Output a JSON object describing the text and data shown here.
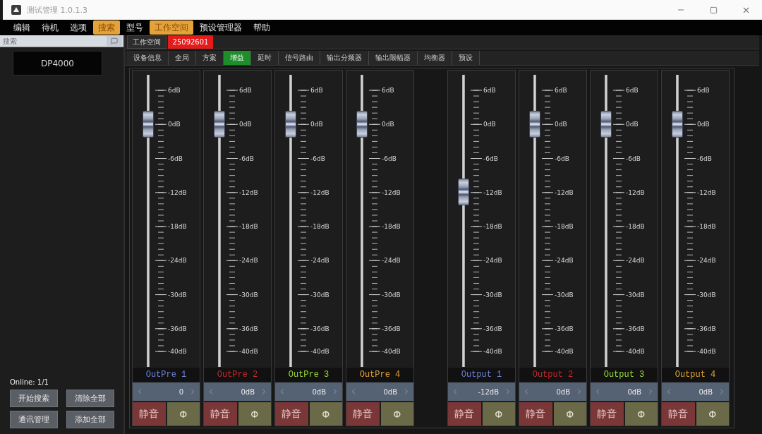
{
  "window": {
    "title": "测试管理 1.0.1.3"
  },
  "menu": [
    {
      "label": "编辑",
      "selected": false
    },
    {
      "label": "待机",
      "selected": false
    },
    {
      "label": "选项",
      "selected": false
    },
    {
      "label": "搜索",
      "selected": true
    },
    {
      "label": "型号",
      "selected": false
    },
    {
      "label": "工作空间",
      "selected": true
    },
    {
      "label": "预设管理器",
      "selected": false
    },
    {
      "label": "帮助",
      "selected": false
    }
  ],
  "sidebar": {
    "search": {
      "placeholder": "搜索"
    },
    "devices": [
      {
        "name": "DP4000",
        "selected": true
      }
    ],
    "status": "Online: 1/1",
    "buttons": [
      "开始搜索",
      "清除全部",
      "通讯管理",
      "添加全部"
    ]
  },
  "workspace": {
    "label": "工作空间",
    "value": "25092601"
  },
  "tabs": [
    {
      "label": "设备信息",
      "selected": false
    },
    {
      "label": "全局",
      "selected": false
    },
    {
      "label": "方案",
      "selected": false
    },
    {
      "label": "增益",
      "selected": true
    },
    {
      "label": "延时",
      "selected": false
    },
    {
      "label": "信号路由",
      "selected": false
    },
    {
      "label": "输出分频器",
      "selected": false
    },
    {
      "label": "输出限幅器",
      "selected": false
    },
    {
      "label": "均衡器",
      "selected": false
    },
    {
      "label": "预设",
      "selected": false
    }
  ],
  "channel_groups": [
    {
      "channels": [
        {
          "name": "OutPre 1",
          "color": "#6f7fd6",
          "level": 0.87,
          "value": "0",
          "scale": [
            "6dB",
            "0dB",
            "-6dB",
            "-12dB",
            "-18dB",
            "-24dB",
            "-30dB",
            "-36dB",
            "-40dB"
          ],
          "mute_label": "静音",
          "phase_label": "Φ"
        },
        {
          "name": "OutPre 2",
          "color": "#c4282c",
          "level": 0.87,
          "value": "0dB",
          "scale": [
            "6dB",
            "0dB",
            "-6dB",
            "-12dB",
            "-18dB",
            "-24dB",
            "-30dB",
            "-36dB",
            "-40dB"
          ],
          "mute_label": "静音",
          "phase_label": "Φ"
        },
        {
          "name": "OutPre 3",
          "color": "#9ad83a",
          "level": 0.87,
          "value": "0dB",
          "scale": [
            "6dB",
            "0dB",
            "-6dB",
            "-12dB",
            "-18dB",
            "-24dB",
            "-30dB",
            "-36dB",
            "-40dB"
          ],
          "mute_label": "静音",
          "phase_label": "Φ"
        },
        {
          "name": "OutPre 4",
          "color": "#e0a030",
          "level": 0.87,
          "value": "0dB",
          "scale": [
            "6dB",
            "0dB",
            "-6dB",
            "-12dB",
            "-18dB",
            "-24dB",
            "-30dB",
            "-36dB",
            "-40dB"
          ],
          "mute_label": "静音",
          "phase_label": "Φ"
        }
      ]
    },
    {
      "channels": [
        {
          "name": "Output 1",
          "color": "#6f7fd6",
          "level": 0.61,
          "value": "-12dB",
          "scale": [
            "6dB",
            "0dB",
            "-6dB",
            "-12dB",
            "-18dB",
            "-24dB",
            "-30dB",
            "-36dB",
            "-40dB"
          ],
          "mute_label": "静音",
          "phase_label": "Φ"
        },
        {
          "name": "Output 2",
          "color": "#c4282c",
          "level": 0.87,
          "value": "0dB",
          "scale": [
            "6dB",
            "0dB",
            "-6dB",
            "-12dB",
            "-18dB",
            "-24dB",
            "-30dB",
            "-36dB",
            "-40dB"
          ],
          "mute_label": "静音",
          "phase_label": "Φ"
        },
        {
          "name": "Output 3",
          "color": "#9ad83a",
          "level": 0.87,
          "value": "0dB",
          "scale": [
            "6dB",
            "0dB",
            "-6dB",
            "-12dB",
            "-18dB",
            "-24dB",
            "-30dB",
            "-36dB",
            "-40dB"
          ],
          "mute_label": "静音",
          "phase_label": "Φ"
        },
        {
          "name": "Output 4",
          "color": "#e0a030",
          "level": 0.87,
          "value": "0dB",
          "scale": [
            "6dB",
            "0dB",
            "-6dB",
            "-12dB",
            "-18dB",
            "-24dB",
            "-30dB",
            "-36dB",
            "-40dB"
          ],
          "mute_label": "静音",
          "phase_label": "Φ"
        }
      ]
    }
  ]
}
